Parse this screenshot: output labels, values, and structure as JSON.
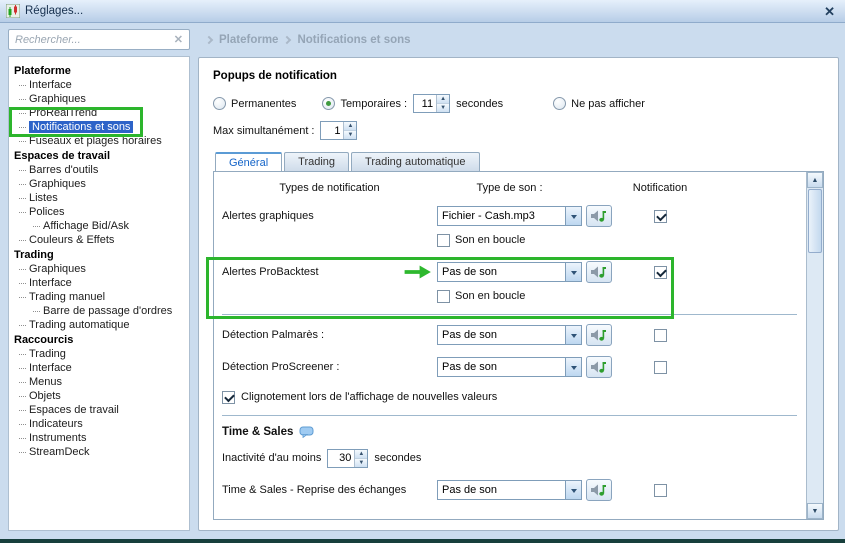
{
  "window": {
    "title": "Réglages..."
  },
  "icons": {
    "close": "✕",
    "clear_search": "✕",
    "up": "▲",
    "down": "▼"
  },
  "sidebar": {
    "search": {
      "placeholder": "Rechercher..."
    },
    "tree": [
      {
        "label": "Plateforme",
        "kind": "header"
      },
      {
        "label": "Interface",
        "kind": "item",
        "level": 1
      },
      {
        "label": "Graphiques",
        "kind": "item",
        "level": 1
      },
      {
        "label": "ProRealTrend",
        "kind": "item",
        "level": 1
      },
      {
        "label": "Notifications et sons",
        "kind": "item",
        "level": 1,
        "selected": true
      },
      {
        "label": "Fuseaux et plages horaires",
        "kind": "item",
        "level": 1
      },
      {
        "label": "Espaces de travail",
        "kind": "header"
      },
      {
        "label": "Barres d'outils",
        "kind": "item",
        "level": 1
      },
      {
        "label": "Graphiques",
        "kind": "item",
        "level": 1
      },
      {
        "label": "Listes",
        "kind": "item",
        "level": 1
      },
      {
        "label": "Polices",
        "kind": "item",
        "level": 1
      },
      {
        "label": "Affichage Bid/Ask",
        "kind": "item",
        "level": 2
      },
      {
        "label": "Couleurs & Effets",
        "kind": "item",
        "level": 1
      },
      {
        "label": "Trading",
        "kind": "header"
      },
      {
        "label": "Graphiques",
        "kind": "item",
        "level": 1
      },
      {
        "label": "Interface",
        "kind": "item",
        "level": 1
      },
      {
        "label": "Trading manuel",
        "kind": "item",
        "level": 1
      },
      {
        "label": "Barre de passage d'ordres",
        "kind": "item",
        "level": 2
      },
      {
        "label": "Trading automatique",
        "kind": "item",
        "level": 1
      },
      {
        "label": "Raccourcis",
        "kind": "header"
      },
      {
        "label": "Trading",
        "kind": "item",
        "level": 1
      },
      {
        "label": "Interface",
        "kind": "item",
        "level": 1
      },
      {
        "label": "Menus",
        "kind": "item",
        "level": 1
      },
      {
        "label": "Objets",
        "kind": "item",
        "level": 1
      },
      {
        "label": "Espaces de travail",
        "kind": "item",
        "level": 1
      },
      {
        "label": "Indicateurs",
        "kind": "item",
        "level": 1
      },
      {
        "label": "Instruments",
        "kind": "item",
        "level": 1
      },
      {
        "label": "StreamDeck",
        "kind": "item",
        "level": 1
      }
    ]
  },
  "breadcrumb": {
    "items": [
      "Plateforme",
      "Notifications et sons"
    ]
  },
  "popups": {
    "title": "Popups de notification",
    "radio_permanentes": "Permanentes",
    "radio_temporaires": "Temporaires :",
    "temporaires_value": "11",
    "temporaires_unit": "secondes",
    "radio_ne_pas_afficher": "Ne pas afficher",
    "max_label": "Max simultanément :",
    "max_value": "1"
  },
  "tabs": [
    {
      "label": "Général",
      "active": true
    },
    {
      "label": "Trading",
      "active": false
    },
    {
      "label": "Trading automatique",
      "active": false
    }
  ],
  "table": {
    "headers": {
      "types": "Types de notification",
      "son": "Type de son :",
      "notification": "Notification"
    },
    "rows": [
      {
        "label": "Alertes graphiques",
        "sound": "Fichier - Cash.mp3",
        "notification_checked": true,
        "loop_label": "Son en boucle",
        "loop_checked": false
      },
      {
        "label": "Alertes ProBacktest",
        "sound": "Pas de son",
        "notification_checked": true,
        "loop_label": "Son en boucle",
        "loop_checked": false
      },
      {
        "label": "Détection Palmarès :",
        "sound": "Pas de son",
        "notification_checked": false
      },
      {
        "label": "Détection ProScreener :",
        "sound": "Pas de son",
        "notification_checked": false
      }
    ],
    "blink_label": "Clignotement lors de l'affichage de nouvelles valeurs",
    "blink_checked": true
  },
  "time_sales": {
    "title": "Time & Sales",
    "inactivity_label": "Inactivité d'au moins",
    "inactivity_value": "30",
    "inactivity_unit": "secondes",
    "row_label": "Time & Sales - Reprise des échanges",
    "row_sound": "Pas de son",
    "row_notification_checked": false
  },
  "colors": {
    "annotation_green": "#2cb52c",
    "selection_blue": "#2d63c8",
    "active_tab_blue": "#1464c8"
  }
}
